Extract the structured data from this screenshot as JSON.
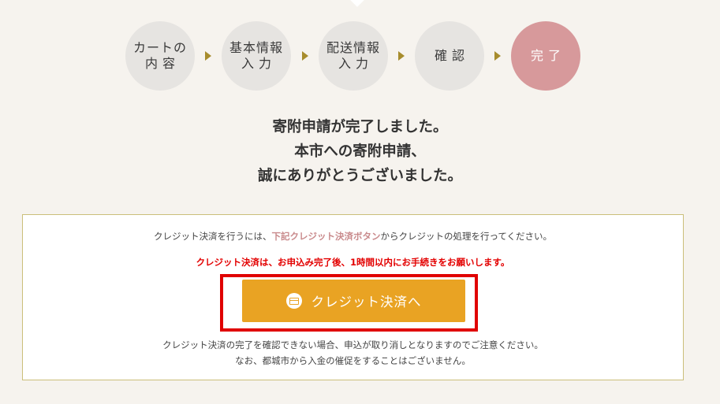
{
  "steps": [
    {
      "line1": "カートの",
      "line2": "内容"
    },
    {
      "line1": "基本情報",
      "line2": "入力"
    },
    {
      "line1": "配送情報",
      "line2": "入力"
    },
    {
      "line1": "確認"
    },
    {
      "line1": "完了",
      "active": true
    }
  ],
  "message": {
    "line1": "寄附申請が完了しました。",
    "line2": "本市への寄附申請、",
    "line3": "誠にありがとうございました。"
  },
  "panel": {
    "instruction_prefix": "クレジット決済を行うには、",
    "instruction_highlight": "下記クレジット決済ボタン",
    "instruction_suffix": "からクレジットの処理を行ってください。",
    "warning": "クレジット決済は、お申込み完了後、1時間以内にお手続きをお願いします。",
    "button_label": "クレジット決済へ",
    "note1": "クレジット決済の完了を確認できない場合、申込が取り消しとなりますのでご注意ください。",
    "note2": "なお、都城市から入金の催促をすることはございません。"
  },
  "colors": {
    "step_inactive": "#e6e4e1",
    "step_active": "#d7999b",
    "arrow": "#a78c2d",
    "button": "#e9a323",
    "warning": "#e30000",
    "highlight_frame": "#e00000"
  },
  "icons": {
    "button_icon": "credit-card-icon"
  }
}
